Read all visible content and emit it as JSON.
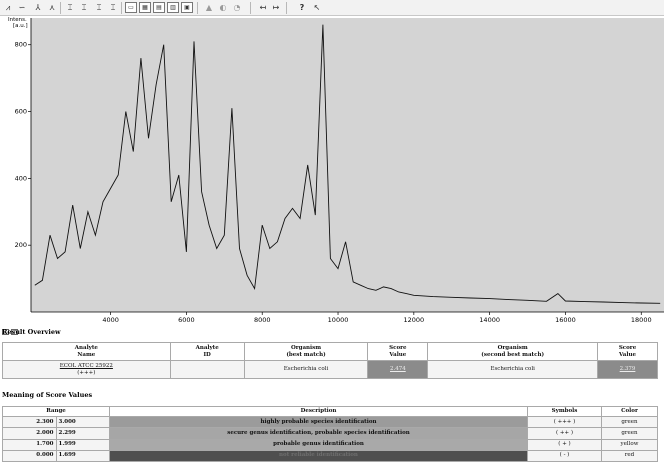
{
  "toolbar": {
    "buttons": [
      {
        "name": "zoom-spectrum-icon",
        "glyph": "⩘"
      },
      {
        "name": "smooth-spectrum-icon",
        "glyph": "∽"
      },
      {
        "name": "baseline-icon",
        "glyph": "⅄"
      },
      {
        "name": "peak-pick-icon",
        "glyph": "⋏"
      },
      {
        "name": "peak-list-add-icon",
        "glyph": "⌶"
      },
      {
        "name": "peak-list-remove-icon",
        "glyph": "⌶"
      },
      {
        "name": "peak-label-icon",
        "glyph": "⌶"
      },
      {
        "name": "peak-edit-icon",
        "glyph": "⌶"
      },
      {
        "name": "layout-single-icon",
        "glyph": "▭"
      },
      {
        "name": "layout-grid-icon",
        "glyph": "▦"
      },
      {
        "name": "layout-stack-icon",
        "glyph": "▤"
      },
      {
        "name": "layout-overlay-icon",
        "glyph": "▥"
      },
      {
        "name": "layout-split-icon",
        "glyph": "▣"
      },
      {
        "name": "peak-marker-icon",
        "glyph": "▲"
      },
      {
        "name": "color-fill-icon",
        "glyph": "◐"
      },
      {
        "name": "annotation-icon",
        "glyph": "◔"
      },
      {
        "name": "zoom-out-x-icon",
        "glyph": "↤"
      },
      {
        "name": "zoom-in-x-icon",
        "glyph": "↦"
      },
      {
        "name": "help-icon",
        "glyph": "?"
      },
      {
        "name": "pointer-help-icon",
        "glyph": "↖"
      }
    ]
  },
  "spectrum": {
    "y_axis_label": "Intens.",
    "y_axis_unit": "[a.u.]",
    "checkboxes": [
      "✓",
      "✓"
    ]
  },
  "chart_data": {
    "type": "line",
    "series": [
      {
        "x": [
          2000,
          2200,
          2400,
          2600,
          2800,
          3000,
          3200,
          3400,
          3600,
          3800,
          4000,
          4200,
          4400,
          4600,
          4800,
          5000,
          5200,
          5400,
          5600,
          5800,
          6000,
          6200,
          6400,
          6600,
          6800,
          7000,
          7200,
          7400,
          7600,
          7800,
          8000,
          8200,
          8400,
          8600,
          8800,
          9000,
          9200,
          9400,
          9600,
          9800,
          10000,
          10200,
          10400,
          10600,
          10800,
          11000,
          11200,
          11400,
          11600,
          11800,
          12000,
          12500,
          13000,
          13500,
          14000,
          14500,
          15000,
          15500,
          15800,
          16000,
          16500,
          17000,
          17500,
          18000,
          18500
        ],
        "values": [
          80,
          95,
          230,
          160,
          180,
          320,
          190,
          300,
          230,
          330,
          370,
          410,
          600,
          480,
          760,
          520,
          680,
          800,
          330,
          410,
          180,
          810,
          360,
          260,
          190,
          230,
          610,
          190,
          110,
          70,
          260,
          190,
          210,
          280,
          310,
          280,
          440,
          290,
          860,
          160,
          130,
          210,
          90,
          80,
          70,
          65,
          75,
          70,
          60,
          55,
          50,
          46,
          44,
          42,
          40,
          37,
          35,
          32,
          55,
          33,
          31,
          30,
          28,
          27,
          26
        ]
      }
    ],
    "x_ticks": [
      "4000",
      "6000",
      "8000",
      "10000",
      "12000",
      "14000",
      "16000",
      "18000"
    ],
    "y_ticks": [
      "200",
      "400",
      "600",
      "800"
    ],
    "xlim": [
      1900,
      18600
    ],
    "ylim": [
      0,
      880
    ],
    "grid": false,
    "line_color": "#111111",
    "plot_background": "#d4d4d4"
  },
  "result_overview": {
    "heading": "Result Overview",
    "headers": {
      "analyte_name": [
        "Analyte",
        "Name"
      ],
      "analyte_id": [
        "Analyte",
        "ID"
      ],
      "organism_best": [
        "Organism",
        "(best match)"
      ],
      "score_1": [
        "Score",
        "Value"
      ],
      "organism_second": [
        "Organism",
        "(second best match)"
      ],
      "score_2": [
        "Score",
        "Value"
      ]
    },
    "rows": [
      {
        "analyte_name": "ECOL ATCC 25922",
        "analyte_symbol": "(+++)",
        "analyte_id": "",
        "organism_best": "Escherichia coli",
        "score_1": "2.474",
        "organism_second": "Escherichia coli",
        "score_2": "2.379"
      }
    ]
  },
  "score_meaning": {
    "heading": "Meaning of Score Values",
    "headers": {
      "range": "Range",
      "description": "Description",
      "symbols": "Symbols",
      "color": "Color"
    },
    "rows": [
      {
        "from": "2.300",
        "to": "3.000",
        "description": "highly probable species identification",
        "symbol": "( +++ )",
        "color": "green"
      },
      {
        "from": "2.000",
        "to": "2.299",
        "description": "secure genus identification, probable species identification",
        "symbol": "( ++ )",
        "color": "green"
      },
      {
        "from": "1.700",
        "to": "1.999",
        "description": "probable genus identification",
        "symbol": "( + )",
        "color": "yellow"
      },
      {
        "from": "0.000",
        "to": "1.699",
        "description": "not reliable identification",
        "symbol": "( - )",
        "color": "red"
      }
    ]
  }
}
